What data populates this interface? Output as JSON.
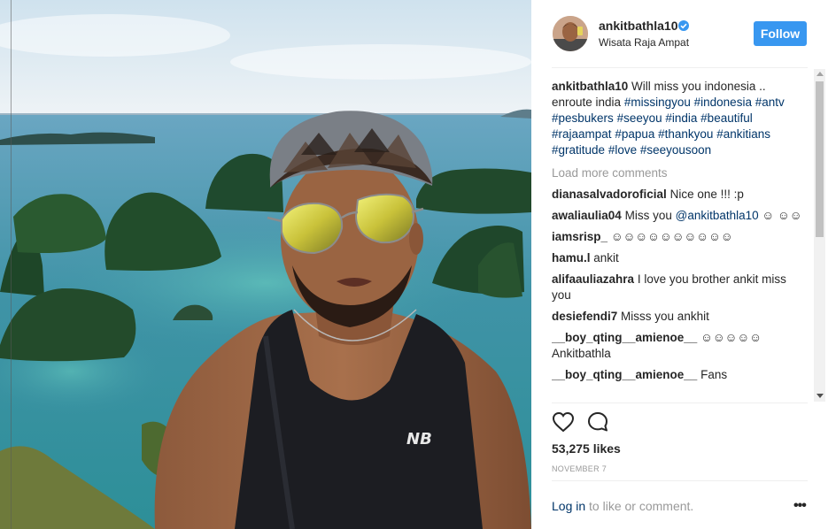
{
  "post": {
    "username": "ankitbathla10",
    "location": "Wisata Raja Ampat",
    "follow_label": "Follow",
    "verified_icon": "verified-badge-icon",
    "accent_color": "#3897f0",
    "link_color": "#003569"
  },
  "caption": {
    "username": "ankitbathla10",
    "text": "Will miss you indonesia .. enroute india",
    "hashtags": [
      "#missingyou",
      "#indonesia",
      "#antv",
      "#pesbukers",
      "#seeyou",
      "#india",
      "#beautiful",
      "#rajaampat",
      "#papua",
      "#thankyou",
      "#ankitians",
      "#gratitude",
      "#love",
      "#seeyousoon"
    ]
  },
  "load_more_label": "Load more comments",
  "comments": [
    {
      "username": "dianasalvadoroficial",
      "text": "Nice one !!! :p"
    },
    {
      "username": "awaliaulia04",
      "text": "Miss you",
      "mention": "@ankitbathla10",
      "text_after": "☺ ☺☺"
    },
    {
      "username": "iamsrisp_",
      "text": "☺☺☺☺☺☺☺☺☺☺"
    },
    {
      "username": "hamu.l",
      "text": "ankit"
    },
    {
      "username": "alifaauliazahra",
      "text": "I love you brother ankit miss you"
    },
    {
      "username": "desiefendi7",
      "text": "Misss you ankhit"
    },
    {
      "username": "__boy_qting__amienoe__",
      "text": "☺☺☺☺☺ Ankitbathla"
    },
    {
      "username": "__boy_qting__amienoe__",
      "text": "Fans"
    }
  ],
  "actions": {
    "like_icon": "heart-icon",
    "comment_icon": "comment-bubble-icon"
  },
  "likes_text": "53,275 likes",
  "date_text": "NOVEMBER 7",
  "footer": {
    "login_link": "Log in",
    "login_rest": " to like or comment.",
    "more_label": "•••",
    "more_icon": "more-options-icon"
  }
}
